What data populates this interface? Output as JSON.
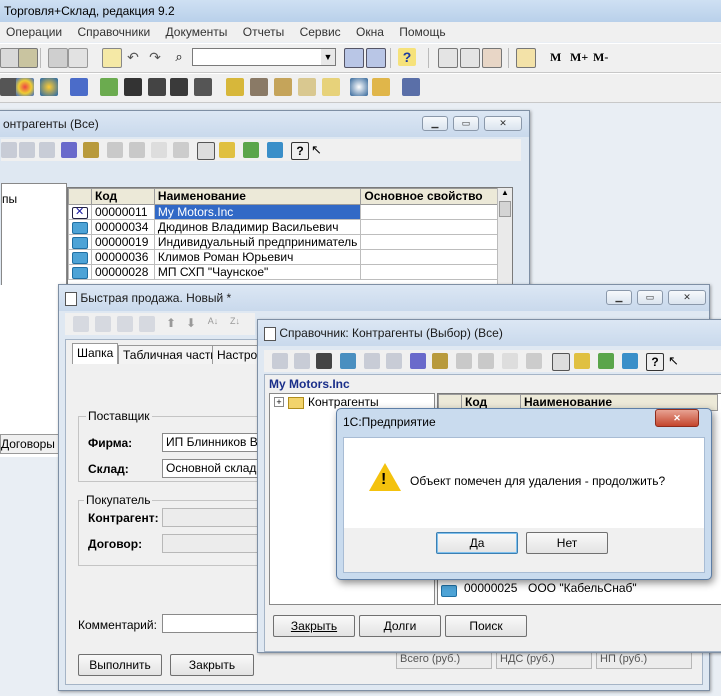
{
  "app": {
    "title": "Торговля+Склад, редакция 9.2",
    "menu": [
      "Операции",
      "Справочники",
      "Документы",
      "Отчеты",
      "Сервис",
      "Окна",
      "Помощь"
    ],
    "toolbar_text": [
      "M",
      "M+",
      "M-"
    ]
  },
  "kontragenty_window": {
    "title": "онтрагенты (Все)",
    "tree_label": "пы",
    "tab_label": "Договоры",
    "columns": [
      "Код",
      "Наименование",
      "Основное свойство"
    ],
    "rows": [
      {
        "code": "00000011",
        "name": "My Motors.Inc",
        "prop": "",
        "selected": true,
        "deleted": true
      },
      {
        "code": "00000034",
        "name": "Дюдинов Владимир Васильевич",
        "prop": "",
        "selected": false,
        "deleted": false
      },
      {
        "code": "00000019",
        "name": "Индивидуальный предприниматель",
        "prop": "",
        "selected": false,
        "deleted": false
      },
      {
        "code": "00000036",
        "name": "Климов Роман Юрьевич",
        "prop": "",
        "selected": false,
        "deleted": false
      },
      {
        "code": "00000028",
        "name": "МП СХП \"Чаунское\"",
        "prop": "",
        "selected": false,
        "deleted": false
      }
    ]
  },
  "quick_sale_window": {
    "title": "Быстрая продажа. Новый *",
    "tabs": [
      "Шапка",
      "Табличная часть",
      "Настро"
    ],
    "supplier_group": "Поставщик",
    "firm_label": "Фирма:",
    "firm_value": "ИП Блинников Ва",
    "warehouse_label": "Склад:",
    "warehouse_value": "Основной склад",
    "buyer_group": "Покупатель",
    "counterparty_label": "Контрагент:",
    "contract_label": "Договор:",
    "comment_label": "Комментарий:",
    "totals": [
      "Всего (руб.)",
      "НДС (руб.)",
      "НП (руб.)"
    ],
    "execute_button": "Выполнить",
    "close_button": "Закрыть"
  },
  "select_window": {
    "title": "Справочник: Контрагенты (Выбор) (Все)",
    "current": "My Motors.Inc",
    "tree_root": "Контрагенты",
    "columns": [
      "Код",
      "Наименование"
    ],
    "last_row": {
      "code": "00000025",
      "name": "ООО \"КабельСнаб\""
    },
    "buttons": [
      "Закрыть",
      "Долги",
      "Поиск"
    ]
  },
  "dialog": {
    "title": "1С:Предприятие",
    "message": "Объект помечен для удаления - продолжить?",
    "yes": "Да",
    "no": "Нет"
  }
}
